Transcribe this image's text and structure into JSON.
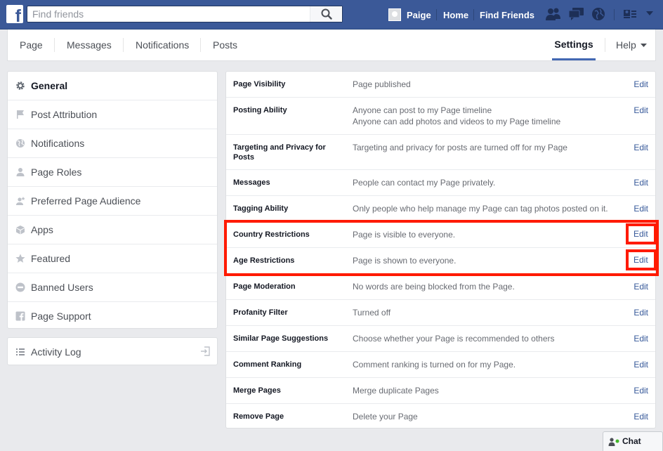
{
  "topbar": {
    "search_placeholder": "Find friends",
    "user_name": "Paige",
    "home_label": "Home",
    "find_friends_label": "Find Friends"
  },
  "tabs": [
    {
      "label": "Page"
    },
    {
      "label": "Messages"
    },
    {
      "label": "Notifications"
    },
    {
      "label": "Posts"
    },
    {
      "label": "Settings"
    },
    {
      "label": "Help"
    }
  ],
  "sidebar": {
    "items": [
      {
        "label": "General",
        "icon": "gear-icon"
      },
      {
        "label": "Post Attribution",
        "icon": "flag-icon"
      },
      {
        "label": "Notifications",
        "icon": "globe-icon"
      },
      {
        "label": "Page Roles",
        "icon": "person-icon"
      },
      {
        "label": "Preferred Page Audience",
        "icon": "person-star-icon"
      },
      {
        "label": "Apps",
        "icon": "cube-icon"
      },
      {
        "label": "Featured",
        "icon": "star-icon"
      },
      {
        "label": "Banned Users",
        "icon": "ban-icon"
      },
      {
        "label": "Page Support",
        "icon": "facebook-icon"
      }
    ],
    "activity_log": "Activity Log"
  },
  "settings": {
    "edit_label": "Edit",
    "rows": [
      {
        "label": "Page Visibility",
        "value": "Page published"
      },
      {
        "label": "Posting Ability",
        "value": "Anyone can post to my Page timeline",
        "value2": "Anyone can add photos and videos to my Page timeline"
      },
      {
        "label": "Targeting and Privacy for Posts",
        "value": "Targeting and privacy for posts are turned off for my Page"
      },
      {
        "label": "Messages",
        "value": "People can contact my Page privately."
      },
      {
        "label": "Tagging Ability",
        "value": "Only people who help manage my Page can tag photos posted on it."
      },
      {
        "label": "Country Restrictions",
        "value": "Page is visible to everyone."
      },
      {
        "label": "Age Restrictions",
        "value": "Page is shown to everyone."
      },
      {
        "label": "Page Moderation",
        "value": "No words are being blocked from the Page."
      },
      {
        "label": "Profanity Filter",
        "value": "Turned off"
      },
      {
        "label": "Similar Page Suggestions",
        "value": "Choose whether your Page is recommended to others"
      },
      {
        "label": "Comment Ranking",
        "value": "Comment ranking is turned on for my Page."
      },
      {
        "label": "Merge Pages",
        "value": "Merge duplicate Pages"
      },
      {
        "label": "Remove Page",
        "value": "Delete your Page"
      }
    ]
  },
  "chat": {
    "label": "Chat"
  },
  "colors": {
    "brand": "#3b5998",
    "highlight": "#ff1a00",
    "link": "#365899"
  }
}
